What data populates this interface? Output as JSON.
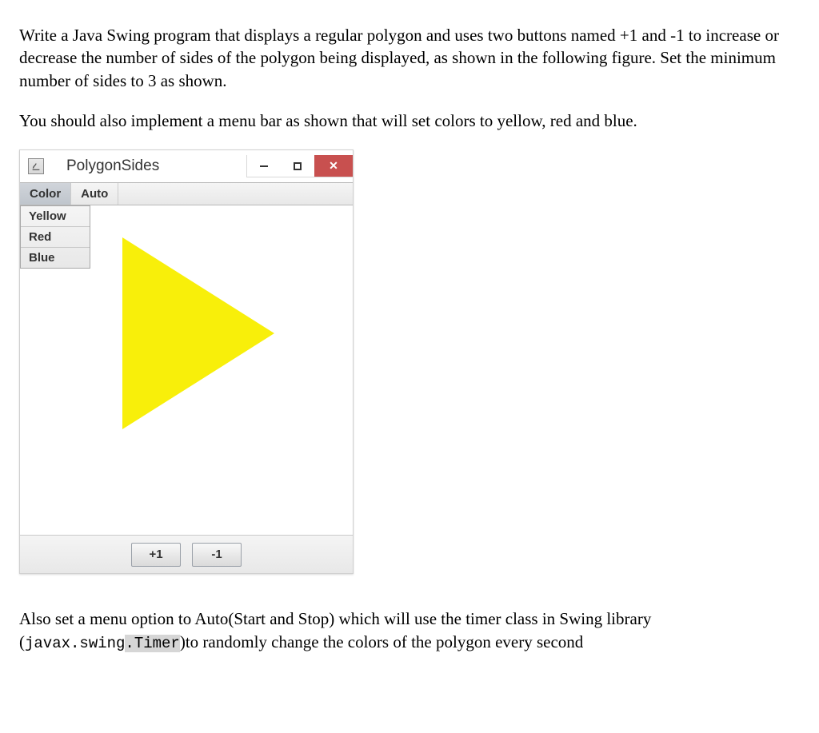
{
  "paragraphs": {
    "p1": "Write a Java Swing program that displays a regular polygon and uses two buttons named +1 and -1 to increase or decrease the number of sides of the polygon being displayed, as shown in the following figure. Set the minimum number of sides to 3 as shown.",
    "p2": "You should also implement a menu bar as shown that will set colors to yellow, red and blue.",
    "p3_a": "Also set a menu option to Auto(Start and Stop) which will  use the timer class in Swing library (",
    "p3_code": "javax.swing.Timer",
    "p3_b": ")to randomly change the colors of the polygon every second"
  },
  "window": {
    "title": "PolygonSides",
    "menubar": {
      "color": "Color",
      "auto": "Auto"
    },
    "dropdown": {
      "yellow": "Yellow",
      "red": "Red",
      "blue": "Blue"
    },
    "buttons": {
      "inc": "+1",
      "dec": "-1"
    },
    "polygon": {
      "sides": 3,
      "fill": "#f8ef0a"
    },
    "controls": {
      "close": "✕"
    }
  }
}
